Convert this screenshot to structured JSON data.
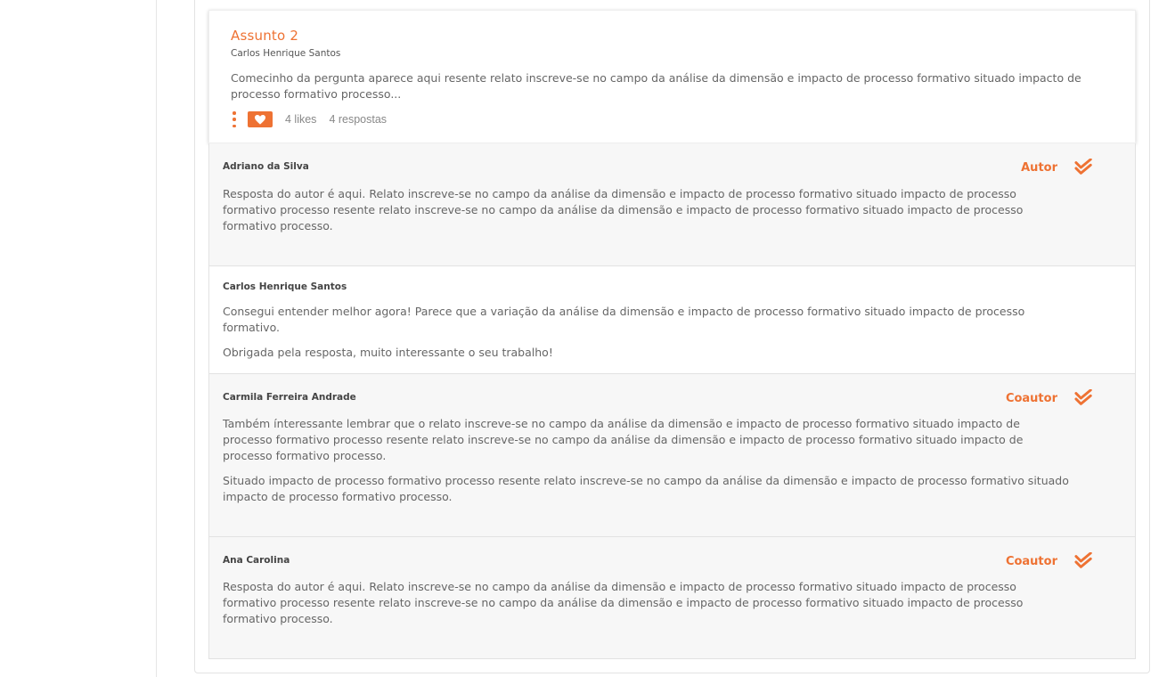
{
  "colors": {
    "accent": "#ee7233"
  },
  "question": {
    "title": "Assunto 2",
    "author": "Carlos Henrique Santos",
    "body": "Comecinho da pergunta aparece aqui resente relato inscreve-se no campo da análise da dimensão e impacto de processo formativo situado impacto de processo formativo processo...",
    "likes": "4 likes",
    "replies": "4 respostas",
    "icons": {
      "menu": "vertical-dots-icon",
      "like": "heart-icon"
    }
  },
  "answers": [
    {
      "name": "Adriano da Silva",
      "role": "Autor",
      "paragraphs": [
        "Resposta do autor é aqui. Relato inscreve-se no campo da análise da dimensão e impacto de processo formativo situado impacto de processo formativo processo resente relato inscreve-se no campo da análise da dimensão e impacto de processo formativo situado impacto de processo formativo processo."
      ],
      "icon": "double-check-icon"
    },
    {
      "name": "Carlos Henrique Santos",
      "role": "",
      "paragraphs": [
        "Consegui entender melhor agora! Parece que a variação da análise da dimensão e impacto de processo formativo situado impacto de processo formativo.",
        "Obrigada pela resposta, muito interessante o seu trabalho!"
      ]
    },
    {
      "name": "Carmila Ferreira Andrade",
      "role": "Coautor",
      "paragraphs": [
        "Também ínteressante lembrar que o relato inscreve-se no campo da análise da dimensão e impacto de processo formativo situado impacto de processo formativo processo resente relato inscreve-se no campo da análise da dimensão e impacto de processo formativo situado impacto de processo formativo processo.",
        "Situado impacto de processo formativo processo resente relato inscreve-se no campo da análise da dimensão e impacto de processo formativo situado impacto de processo formativo processo."
      ],
      "icon": "double-check-icon"
    },
    {
      "name": "Ana Carolina",
      "role": "Coautor",
      "paragraphs": [
        "Resposta do autor é aqui. Relato inscreve-se no campo da análise da dimensão e impacto de processo formativo situado impacto de processo formativo processo resente relato inscreve-se no campo da análise da dimensão e impacto de processo formativo situado impacto de processo formativo processo."
      ],
      "icon": "double-check-icon"
    }
  ]
}
